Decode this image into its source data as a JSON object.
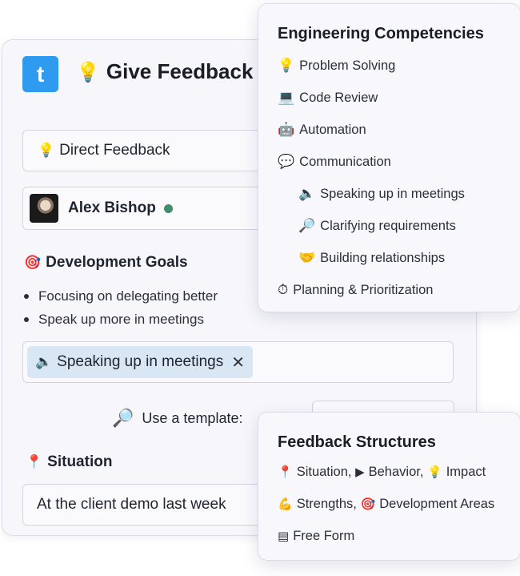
{
  "logo": {
    "letter": "t"
  },
  "header": {
    "icon": "lightbulb-icon",
    "emoji": "💡",
    "title": "Give Feedback"
  },
  "feedback_type": {
    "emoji": "💡",
    "label": "Direct Feedback"
  },
  "recipient": {
    "name": "Alex Bishop",
    "status_color": "#3e8e6a"
  },
  "development_goals": {
    "emoji": "🎯",
    "heading": "Development Goals",
    "items": [
      "Focusing on delegating better",
      "Speak up more in meetings"
    ]
  },
  "selected_competency": {
    "emoji": "🔈",
    "label": "Speaking up in meetings",
    "remove": "✕"
  },
  "template": {
    "emoji": "🔎",
    "label": "Use a template:"
  },
  "situation": {
    "emoji": "📍",
    "heading": "Situation",
    "value": "At the client demo last week"
  },
  "competencies_popup": {
    "title": "Engineering Competencies",
    "items": [
      {
        "emoji": "💡",
        "label": "Problem Solving"
      },
      {
        "emoji": "💻",
        "label": "Code Review"
      },
      {
        "emoji": "🤖",
        "label": "Automation"
      },
      {
        "emoji": "💬",
        "label": "Communication"
      },
      {
        "emoji": "🔈",
        "label": "Speaking up in meetings"
      },
      {
        "emoji": "🔎",
        "label": "Clarifying requirements"
      },
      {
        "emoji": "🤝",
        "label": "Building relationships"
      },
      {
        "emoji": "⏱",
        "label": "Planning & Prioritization"
      }
    ]
  },
  "structures_popup": {
    "title": "Feedback Structures",
    "sbi": {
      "e1": "📍",
      "t1": "Situation,",
      "e2": "▶",
      "t2": "Behavior,",
      "e3": "💡",
      "t3": "Impact"
    },
    "strengths": {
      "e1": "💪",
      "t1": "Strengths,",
      "e2": "🎯",
      "t2": "Development Areas"
    },
    "free_form": {
      "e1": "▤",
      "t1": "Free Form"
    }
  },
  "colors": {
    "accent": "#2e9bf0",
    "chip_bg": "#d9e6f3",
    "online": "#3e8e6a"
  }
}
